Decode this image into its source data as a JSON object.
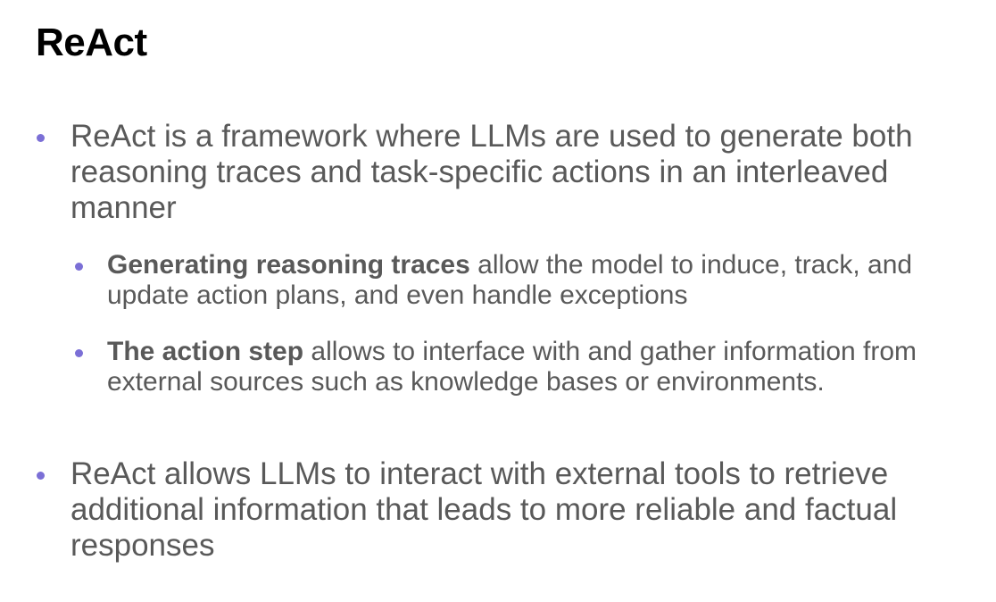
{
  "slide": {
    "title": "ReAct",
    "bullets": [
      {
        "text": "ReAct is a framework where LLMs are used to generate both reasoning traces and task-specific actions in an interleaved manner"
      },
      {
        "bold": "Generating reasoning traces",
        "text": " allow the model to induce, track, and update action plans, and even handle exceptions"
      },
      {
        "bold": "The action step",
        "text": " allows to interface with and gather information from external sources such as knowledge bases or environments."
      },
      {
        "text": "ReAct allows LLMs to interact with external tools to retrieve additional information that leads to more reliable and factual responses"
      }
    ]
  },
  "colors": {
    "bullet_dot": "#7b6fd6",
    "body_text": "#595959",
    "title_text": "#000000"
  }
}
